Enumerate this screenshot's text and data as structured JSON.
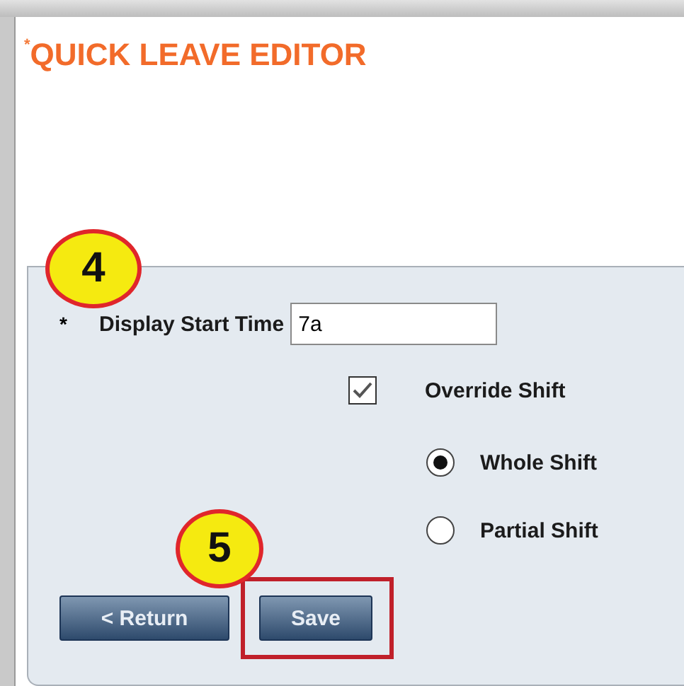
{
  "title": {
    "marker": "*",
    "text": "QUICK LEAVE EDITOR"
  },
  "form": {
    "start_time": {
      "required_marker": "*",
      "label": "Display Start Time",
      "value": "7a"
    },
    "override": {
      "label": "Override Shift",
      "checked": true
    },
    "shift_options": [
      {
        "label": "Whole Shift",
        "selected": true
      },
      {
        "label": "Partial Shift",
        "selected": false
      }
    ]
  },
  "buttons": [
    {
      "label": "< Return",
      "highlighted": false
    },
    {
      "label": "Save",
      "highlighted": true
    }
  ],
  "callouts": [
    {
      "number": "4"
    },
    {
      "number": "5"
    }
  ]
}
